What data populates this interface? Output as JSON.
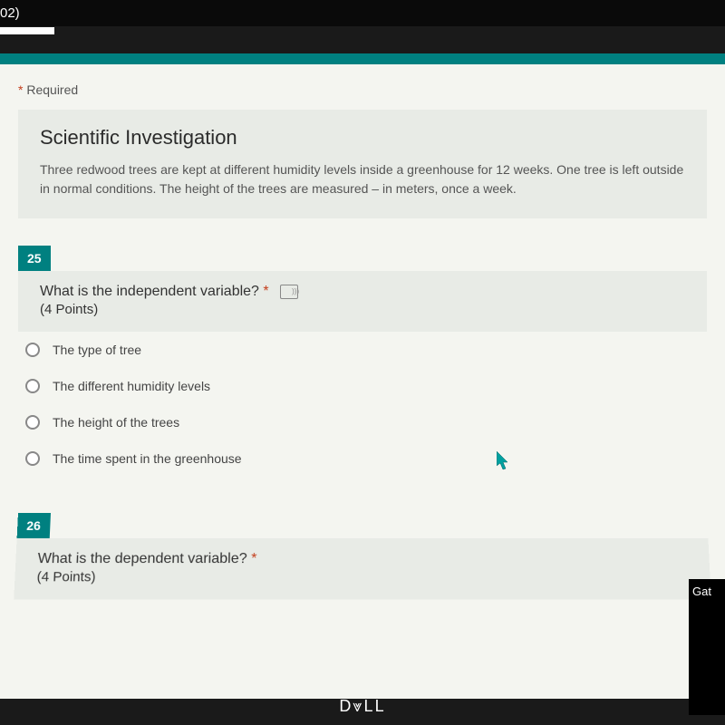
{
  "topbar": {
    "text": "02)"
  },
  "form": {
    "required_label": "Required",
    "section": {
      "title": "Scientific Investigation",
      "description": "Three redwood trees are kept at different humidity levels inside a greenhouse for 12 weeks. One tree is left outside in normal conditions. The height of the trees are measured – in meters, once a week."
    },
    "q25": {
      "number": "25",
      "text": "What is the independent variable?",
      "points": "(4 Points)",
      "options": [
        "The type of tree",
        "The different humidity levels",
        "The height of the trees",
        "The time spent in the greenhouse"
      ]
    },
    "q26": {
      "number": "26",
      "text": "What is the dependent variable?",
      "points": "(4 Points)"
    }
  },
  "overlay": {
    "label": "Gat"
  },
  "brand": "D⩔LL"
}
